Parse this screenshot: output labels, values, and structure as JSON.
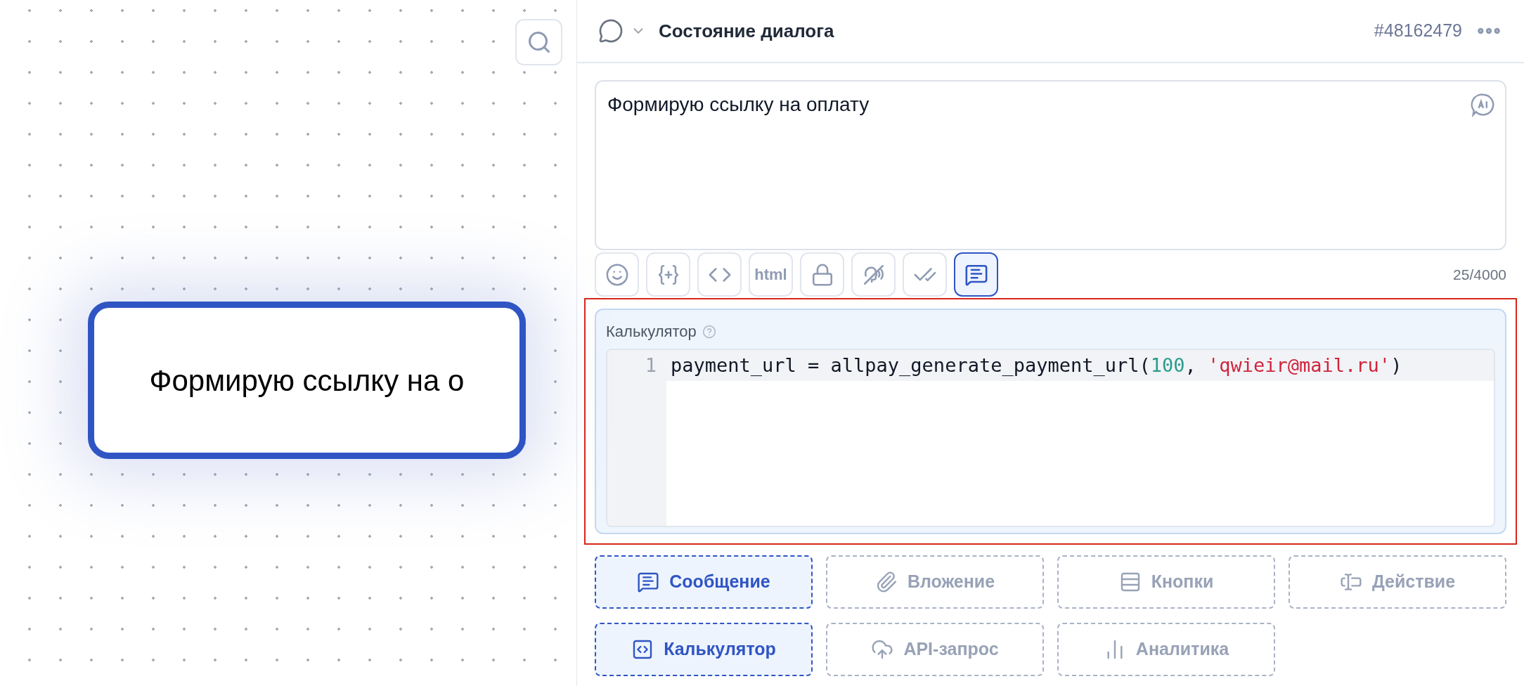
{
  "canvas": {
    "node": {
      "text": "Формирую ссылку на о",
      "selected": true
    }
  },
  "header": {
    "title": "Состояние диалога",
    "id": "#48162479"
  },
  "message": {
    "value": "Формирую ссылку на оплату",
    "counter": "25/4000"
  },
  "toolbar": [
    {
      "kind": "emoji",
      "selected": false
    },
    {
      "kind": "variable",
      "selected": false
    },
    {
      "kind": "code",
      "selected": false
    },
    {
      "kind": "html",
      "label": "html",
      "selected": false
    },
    {
      "kind": "lock",
      "selected": false
    },
    {
      "kind": "mute",
      "selected": false
    },
    {
      "kind": "read",
      "selected": false
    },
    {
      "kind": "message",
      "selected": true
    }
  ],
  "calculator": {
    "label": "Калькулятор",
    "selected": true,
    "lines": [
      {
        "number": "1",
        "tokens": [
          {
            "kind": "plain",
            "text": "payment_url = allpay_generate_payment_url("
          },
          {
            "kind": "number",
            "text": "100"
          },
          {
            "kind": "plain",
            "text": ", "
          },
          {
            "kind": "string",
            "text": "'qwieir@mail.ru'"
          },
          {
            "kind": "plain",
            "text": ")"
          }
        ]
      }
    ]
  },
  "blocks": [
    {
      "kind": "message",
      "label": "Сообщение",
      "selected": true
    },
    {
      "kind": "attachment",
      "label": "Вложение",
      "selected": false
    },
    {
      "kind": "buttons",
      "label": "Кнопки",
      "selected": false
    },
    {
      "kind": "action",
      "label": "Действие",
      "selected": false
    },
    {
      "kind": "calculator",
      "label": "Калькулятор",
      "selected": true
    },
    {
      "kind": "api",
      "label": "API-запрос",
      "selected": false
    },
    {
      "kind": "analytics",
      "label": "Аналитика",
      "selected": false
    }
  ]
}
